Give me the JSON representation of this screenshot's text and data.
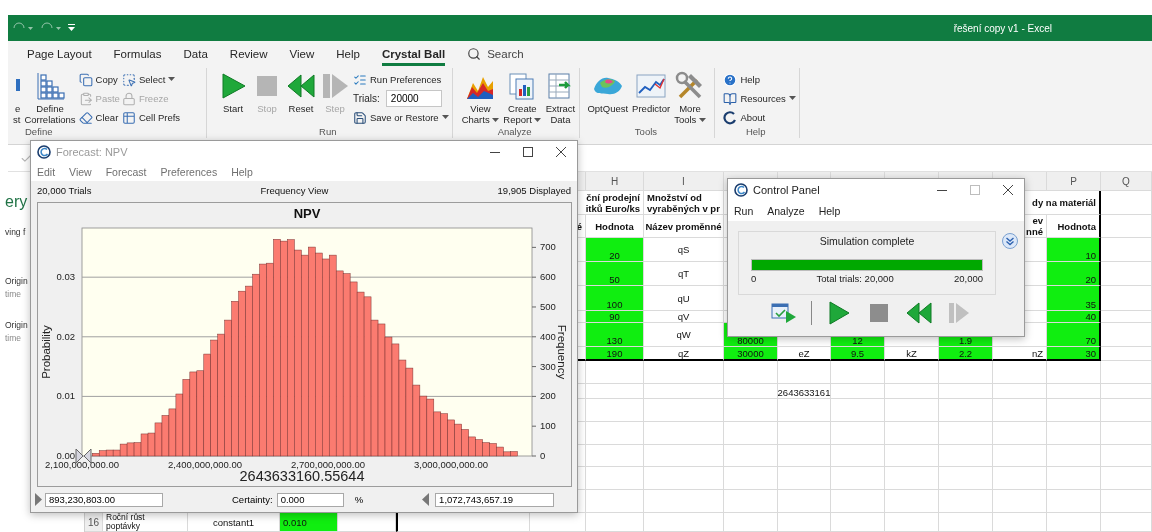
{
  "title_bar": {
    "title": "řešení copy v1 - Excel"
  },
  "ribbon_tabs": [
    {
      "label": "Page Layout",
      "selected": false
    },
    {
      "label": "Formulas",
      "selected": false
    },
    {
      "label": "Data",
      "selected": false
    },
    {
      "label": "Review",
      "selected": false
    },
    {
      "label": "View",
      "selected": false
    },
    {
      "label": "Help",
      "selected": false
    },
    {
      "label": "Crystal Ball",
      "selected": true
    }
  ],
  "search": {
    "label": "Search"
  },
  "ribbon_groups": [
    {
      "label": "Define",
      "items": [
        {
          "kind": "large",
          "label": "e\nst",
          "dropdown": false,
          "disabled": false
        },
        {
          "kind": "large",
          "label": "Define\nCorrelations",
          "dropdown": false,
          "disabled": false
        },
        {
          "kind": "stack",
          "buttons": [
            {
              "kind": "button",
              "label": "Copy",
              "dropdown": false,
              "disabled": false
            },
            {
              "kind": "button",
              "label": "Paste",
              "dropdown": false,
              "disabled": true
            },
            {
              "kind": "button",
              "label": "Clear",
              "dropdown": false,
              "disabled": false
            }
          ]
        },
        {
          "kind": "stack",
          "buttons": [
            {
              "kind": "button",
              "label": "Select",
              "dropdown": true,
              "disabled": false
            },
            {
              "kind": "button",
              "label": "Freeze",
              "dropdown": false,
              "disabled": true
            },
            {
              "kind": "button",
              "label": "Cell Prefs",
              "dropdown": false,
              "disabled": false
            }
          ]
        }
      ]
    },
    {
      "label": "Run",
      "items": [
        {
          "kind": "large",
          "label": "Start",
          "dropdown": false,
          "disabled": false
        },
        {
          "kind": "large",
          "label": "Stop",
          "dropdown": false,
          "disabled": true
        },
        {
          "kind": "large",
          "label": "Reset",
          "dropdown": false,
          "disabled": false
        },
        {
          "kind": "large",
          "label": "Step",
          "dropdown": false,
          "disabled": true
        },
        {
          "kind": "stack",
          "buttons": [
            {
              "kind": "button",
              "label": "Run Preferences",
              "dropdown": false,
              "disabled": false
            },
            {
              "kind": "field",
              "label": "Trials:",
              "value": "20000"
            },
            {
              "kind": "button",
              "label": "Save or Restore",
              "dropdown": true,
              "disabled": false
            }
          ]
        }
      ]
    },
    {
      "label": "Analyze",
      "items": [
        {
          "kind": "large",
          "label": "View\nCharts",
          "dropdown": true,
          "disabled": false
        },
        {
          "kind": "large",
          "label": "Create\nReport",
          "dropdown": true,
          "disabled": false
        },
        {
          "kind": "large",
          "label": "Extract\nData",
          "dropdown": false,
          "disabled": false
        }
      ]
    },
    {
      "label": "Tools",
      "items": [
        {
          "kind": "large",
          "label": "OptQuest",
          "dropdown": false,
          "disabled": false
        },
        {
          "kind": "large",
          "label": "Predictor",
          "dropdown": false,
          "disabled": false
        },
        {
          "kind": "large",
          "label": "More\nTools",
          "dropdown": true,
          "disabled": false
        }
      ]
    },
    {
      "label": "Help",
      "items": [
        {
          "kind": "stack",
          "buttons": [
            {
              "kind": "button",
              "label": "Help",
              "dropdown": false,
              "disabled": false
            },
            {
              "kind": "button",
              "label": "Resources",
              "dropdown": true,
              "disabled": false
            },
            {
              "kind": "button",
              "label": "About",
              "dropdown": false,
              "disabled": false
            }
          ]
        }
      ]
    }
  ],
  "recovery_pane": {
    "heading": "ery",
    "message": "ving f",
    "files": [
      {
        "name": "Origin",
        "time": "time"
      },
      {
        "name": "Origin",
        "time": "time"
      }
    ]
  },
  "sheet": {
    "column_headers": {
      "H": "H",
      "I": "I",
      "P": "P",
      "Q": "Q"
    },
    "rows": [
      {
        "cells": {
          "H": {
            "text": "ční prodejní\nitků Euro/ks",
            "highlighted": false
          },
          "I": {
            "text": "Množství od\nvyraběných v pr",
            "highlighted": false
          },
          "P": {
            "text": "dy na materiál",
            "highlighted": false
          }
        }
      },
      {
        "cells": {
          "G": {
            "text": "é",
            "highlighted": false
          },
          "H": {
            "text": "Hodnota",
            "highlighted": false
          },
          "I": {
            "text": "Název proměnné",
            "highlighted": false
          },
          "O": {
            "text": "ev\nnné",
            "highlighted": false
          },
          "P": {
            "text": "Hodnota",
            "highlighted": false
          }
        }
      },
      {
        "cells": {
          "H": {
            "text": "20",
            "highlighted": true
          },
          "I": {
            "text": "qS",
            "highlighted": false
          },
          "P": {
            "text": "10",
            "highlighted": true
          }
        }
      },
      {
        "cells": {
          "H": {
            "text": "50",
            "highlighted": true
          },
          "I": {
            "text": "qT",
            "highlighted": false
          },
          "P": {
            "text": "20",
            "highlighted": true
          }
        }
      },
      {
        "cells": {
          "H": {
            "text": "100",
            "highlighted": true
          },
          "I": {
            "text": "qU",
            "highlighted": false
          },
          "P": {
            "text": "35",
            "highlighted": true
          }
        }
      },
      {
        "cells": {
          "H": {
            "text": "90",
            "highlighted": true
          },
          "I": {
            "text": "qV",
            "highlighted": false
          },
          "P": {
            "text": "40",
            "highlighted": true
          }
        }
      },
      {
        "cells": {
          "H": {
            "text": "130",
            "highlighted": true
          },
          "I": {
            "text": "qW",
            "highlighted": false
          },
          "J": {
            "text": "80000",
            "highlighted": true
          },
          "L": {
            "text": "12",
            "highlighted": true
          },
          "N": {
            "text": "1.9",
            "highlighted": true
          },
          "P": {
            "text": "70",
            "highlighted": true
          }
        }
      },
      {
        "cells": {
          "H": {
            "text": "190",
            "highlighted": true
          },
          "I": {
            "text": "qZ",
            "highlighted": false
          },
          "J": {
            "text": "30000",
            "highlighted": true
          },
          "K": {
            "text": "eZ",
            "highlighted": false
          },
          "L": {
            "text": "9.5",
            "highlighted": true
          },
          "M": {
            "text": "kZ",
            "highlighted": false
          },
          "N": {
            "text": "2.2",
            "highlighted": true
          },
          "O": {
            "text": "nZ",
            "highlighted": false
          },
          "P": {
            "text": "30",
            "highlighted": true
          }
        }
      },
      {
        "cells": {}
      },
      {
        "cells": {
          "K": {
            "text": "2643633161",
            "highlighted": false
          }
        }
      },
      {
        "number": "16",
        "cells": {
          "B": {
            "text": "Roční růst\npoptávky",
            "highlighted": false
          },
          "C": {
            "text": "constant1",
            "highlighted": false
          },
          "D": {
            "text": "0.010",
            "highlighted": true
          }
        }
      }
    ]
  },
  "forecast_window": {
    "title": "Forecast: NPV",
    "active": false,
    "menu": [
      "Edit",
      "View",
      "Forecast",
      "Preferences",
      "Help"
    ],
    "trials": "20,000 Trials",
    "view": "Frequency View",
    "displayed": "19,905 Displayed",
    "probability_axis": {
      "label": "Probability",
      "ticks": [
        "0.03",
        "0.02",
        "0.01",
        "0.00"
      ]
    },
    "value_readout": "2643633160.55644",
    "chart_data": {
      "type": "bar",
      "title": "NPV",
      "ylabel": "Frequency",
      "grid": true,
      "x": [
        2133500000,
        2150500000,
        2167500000,
        2184500000,
        2201500000,
        2218500000,
        2235500000,
        2252500000,
        2269500000,
        2286500000,
        2303500000,
        2320500000,
        2337500000,
        2354500000,
        2371500000,
        2388500000,
        2405500000,
        2422500000,
        2439500000,
        2456500000,
        2473500000,
        2490500000,
        2507500000,
        2524500000,
        2541500000,
        2558500000,
        2575500000,
        2592500000,
        2609500000,
        2626500000,
        2643500000,
        2660500000,
        2677500000,
        2694500000,
        2711500000,
        2728500000,
        2745500000,
        2762500000,
        2779500000,
        2796500000,
        2813500000,
        2830500000,
        2847500000,
        2864500000,
        2881500000,
        2898500000,
        2915500000,
        2932500000,
        2949500000,
        2966500000,
        2983500000,
        3000500000,
        3017500000,
        3034500000,
        3051500000,
        3068500000,
        3085500000,
        3102500000,
        3119500000,
        3136500000,
        3153500000
      ],
      "series": [
        {
          "color": "#fb7b70",
          "values": [
            9,
            18,
            20,
            20,
            40,
            44,
            45,
            74,
            77,
            111,
            136,
            158,
            208,
            257,
            282,
            286,
            342,
            389,
            409,
            456,
            519,
            553,
            570,
            610,
            644,
            647,
            727,
            721,
            726,
            691,
            674,
            701,
            681,
            661,
            674,
            621,
            612,
            584,
            550,
            534,
            456,
            443,
            399,
            376,
            322,
            295,
            238,
            201,
            191,
            148,
            142,
            121,
            107,
            89,
            64,
            55,
            45,
            42,
            30,
            14,
            15
          ]
        }
      ],
      "xlim": [
        2100000000,
        3197500000
      ],
      "ylim": [
        0,
        765
      ],
      "xticks": [
        {
          "value": 2100000000,
          "label": "2,100,000,000.00"
        },
        {
          "value": 2400000000,
          "label": "2,400,000,000.00"
        },
        {
          "value": 2700000000,
          "label": "2,700,000,000.00"
        },
        {
          "value": 3000000000,
          "label": "3,000,000,000.00"
        }
      ],
      "yticks": [
        0,
        100,
        200,
        300,
        400,
        500,
        600,
        700
      ]
    },
    "certainty": {
      "lower": "893,230,803.00",
      "label": "Certainty:",
      "value": "0.000",
      "unit": "%",
      "upper": "1,072,743,657.19"
    }
  },
  "control_panel": {
    "title": "Control Panel",
    "active": true,
    "maximize_disabled": true,
    "menu": [
      "Run",
      "Analyze",
      "Help"
    ],
    "status": "Simulation complete",
    "progress": {
      "level": 1,
      "min": "0",
      "caption": "Total trials: 20,000",
      "max": "20,000"
    },
    "buttons": [
      {
        "disabled": false
      },
      {
        "disabled": false
      },
      {
        "disabled": false
      },
      {
        "disabled": false
      },
      {
        "disabled": true
      }
    ]
  }
}
